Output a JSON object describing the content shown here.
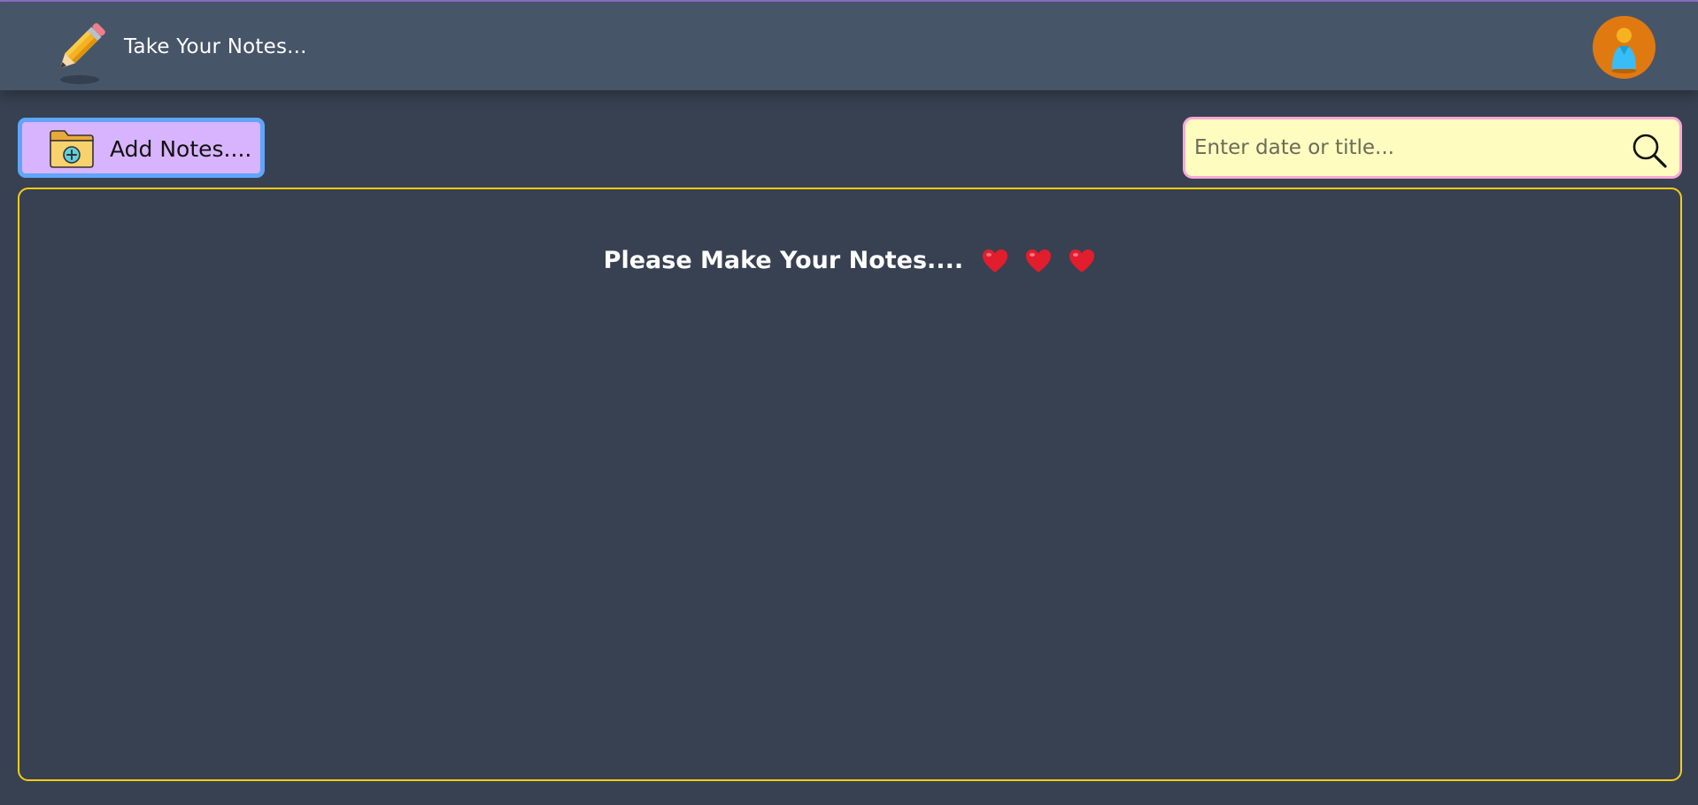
{
  "header": {
    "title": "Take Your Notes...",
    "brand_icon": "pencil-icon",
    "avatar_icon": "user-avatar-icon"
  },
  "toolbar": {
    "add_label": "Add Notes....",
    "add_icon": "folder-add-icon",
    "search_placeholder": "Enter date or title...",
    "search_value": ""
  },
  "main": {
    "empty_message": "Please Make Your Notes....",
    "empty_icons": [
      "heart-icon",
      "heart-icon",
      "heart-icon"
    ]
  },
  "colors": {
    "background": "#374151",
    "navbar": "#475569",
    "add_button_bg": "#d8b4fe",
    "add_button_border": "#60a5fa",
    "search_bg": "#fefcbf",
    "search_border": "#f9a8d4",
    "panel_border": "#facc15",
    "avatar_bg": "#e07a10",
    "heart": "#e11d2e"
  }
}
